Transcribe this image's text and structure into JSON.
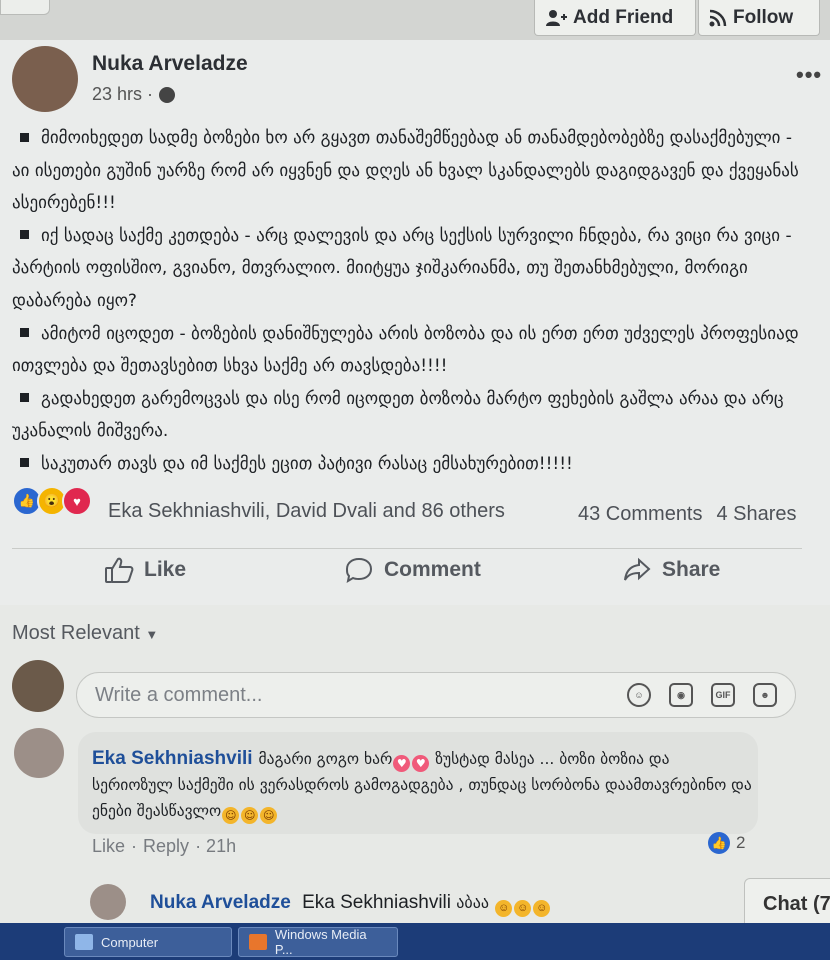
{
  "header": {
    "add_friend": "Add Friend",
    "follow": "Follow"
  },
  "post": {
    "author": "Nuka Arveladze",
    "time": "23 hrs ·",
    "paragraphs": [
      "მიმოიხედეთ სადმე ბოზები ხო არ გყავთ თანაშემწეებად ან თანამდებობებზე დასაქმებული - აი ისეთები გუშინ უარზე რომ არ იყვნენ და დღეს ან ხვალ სკანდალებს დაგიდგავენ და ქვეყანას ასეირებენ!!!",
      "იქ სადაც საქმე კეთდება - არც დალევის და არც სექსის სურვილი ჩნდება, რა ვიცი რა ვიცი - პარტიის ოფისშიო, გვიანო, მთვრალიო. მიიტყუა ჯიშკარიანმა, თუ შეთანხმებული, მორიგი დაბარება იყო?",
      "ამიტომ იცოდეთ - ბოზების დანიშნულება არის ბოზობა და ის ერთ ერთ უძველეს პროფესიად ითვლება და შეთავსებით სხვა საქმე არ თავსდება!!!!",
      "გადახედეთ გარემოცვას და ისე რომ იცოდეთ ბოზობა მარტო ფეხების გაშლა არაა და არც უკანალის მიშვერა.",
      "საკუთარ თავს და იმ საქმეს ეცით პატივი რასაც ემსახურებით!!!!!"
    ],
    "reaction_names": "Eka Sekhniashvili, David Dvali and 86 others",
    "comments_count": "43 Comments",
    "shares_count": "4 Shares"
  },
  "actions": {
    "like": "Like",
    "comment": "Comment",
    "share": "Share"
  },
  "comments_section": {
    "sort_label": "Most Relevant",
    "input_placeholder": "Write a comment...",
    "input_icons": [
      "emoji-icon",
      "camera-icon",
      "gif-icon",
      "sticker-icon"
    ],
    "gif_label": "GIF",
    "comment": {
      "author": "Eka Sekhniashvili",
      "text_part1": "მაგარი გოგო ხარ",
      "text_part2": " ზუსტად მასეა ... ბოზი ბოზია და სერიოზულ საქმეში ის ვერასდროს გამოგადგება , თუნდაც სორბონა დაამთავრებინო და ენები შეასწავლო",
      "like": "Like",
      "reply": "Reply",
      "age": "· 21h",
      "likes": "2"
    },
    "reply": {
      "author": "Nuka Arveladze",
      "mention": "Eka Sekhniashvili",
      "text": "აბაა"
    }
  },
  "chat": {
    "label": "Chat (7"
  },
  "taskbar": {
    "items": [
      "Computer",
      "Windows Media P..."
    ]
  },
  "colors": {
    "name_link": "#1f4f99",
    "like_blue": "#2b67d0",
    "taskbar": "#1c3c78"
  }
}
